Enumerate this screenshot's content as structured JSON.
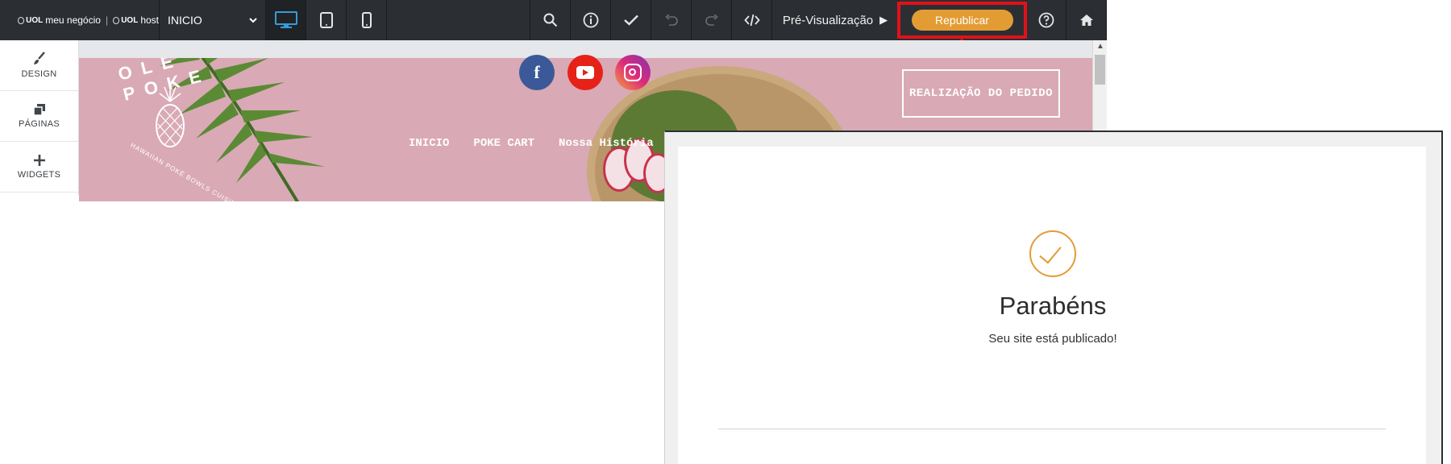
{
  "toolbar": {
    "brand_left": "meu negócio",
    "brand_uol_1": "UOL",
    "brand_divider": "|",
    "brand_uol_2": "UOL",
    "brand_right": "host",
    "page_select": "INICIO",
    "preview_label": "Pré-Visualização",
    "republish_label": "Republicar",
    "icons": [
      "desktop-icon",
      "tablet-icon",
      "mobile-icon",
      "search-icon",
      "info-icon",
      "check-icon",
      "undo-icon",
      "redo-icon",
      "code-icon",
      "help-icon",
      "home-icon"
    ]
  },
  "sidebar": {
    "items": [
      {
        "label": "DESIGN",
        "icon": "brush-icon"
      },
      {
        "label": "PÁGINAS",
        "icon": "pages-icon"
      },
      {
        "label": "WIDGETS",
        "icon": "plus-icon"
      }
    ]
  },
  "site": {
    "logo_title": "OLÉ POKE",
    "logo_subtitle": "HAWAIIAN POKÉ BOWLS CUISINE",
    "order_button": "REALIZAÇÃO DO PEDIDO",
    "nav": [
      "INICIO",
      "POKE CART",
      "Nossa História"
    ],
    "social": [
      "facebook-icon",
      "youtube-icon",
      "instagram-icon"
    ],
    "facebook_glyph": "f"
  },
  "modal": {
    "title": "Parabéns",
    "message": "Seu site está publicado!"
  },
  "colors": {
    "toolbar_bg": "#2b2f33",
    "accent": "#e39c34",
    "highlight": "#e0111a",
    "active_device": "#3a9ad9"
  }
}
